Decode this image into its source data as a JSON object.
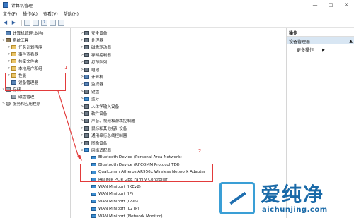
{
  "window": {
    "title": "计算机管理",
    "controls": [
      "—",
      "□",
      "✕"
    ]
  },
  "menubar": [
    "文件(F)",
    "操作(A)",
    "查看(V)",
    "帮助(H)"
  ],
  "toolbar": [
    "back-icon",
    "forward-icon",
    "folder-icon",
    "properties-icon",
    "help-icon",
    "view-icon",
    "monitor-icon"
  ],
  "left_tree": [
    {
      "label": "计算机管理(本地)",
      "arrow": "",
      "icon": "pc"
    },
    {
      "label": "系统工具",
      "arrow": "∨",
      "icon": "tool"
    },
    {
      "label": "任务计划程序",
      "arrow": ">",
      "icon": "folder"
    },
    {
      "label": "事件查看器",
      "arrow": ">",
      "icon": "folder"
    },
    {
      "label": "共享文件夹",
      "arrow": ">",
      "icon": "folder"
    },
    {
      "label": "本地用户和组",
      "arrow": ">",
      "icon": "folder"
    },
    {
      "label": "性能",
      "arrow": ">",
      "icon": "folder"
    },
    {
      "label": "设备管理器",
      "arrow": "",
      "icon": "pc"
    },
    {
      "label": "存储",
      "arrow": "∨",
      "icon": "disk"
    },
    {
      "label": "磁盘管理",
      "arrow": "",
      "icon": "disk"
    },
    {
      "label": "服务和应用程序",
      "arrow": ">",
      "icon": "svc"
    }
  ],
  "device_tree": [
    {
      "label": "安全设备",
      "arrow": ">",
      "icon": "dev"
    },
    {
      "label": "处理器",
      "arrow": ">",
      "icon": "dev"
    },
    {
      "label": "磁盘驱动器",
      "arrow": ">",
      "icon": "dev"
    },
    {
      "label": "存储控制器",
      "arrow": ">",
      "icon": "dev"
    },
    {
      "label": "打印队列",
      "arrow": ">",
      "icon": "dev"
    },
    {
      "label": "电池",
      "arrow": ">",
      "icon": "dev"
    },
    {
      "label": "计算机",
      "arrow": ">",
      "icon": "pc"
    },
    {
      "label": "监视器",
      "arrow": ">",
      "icon": "pc"
    },
    {
      "label": "键盘",
      "arrow": ">",
      "icon": "dev"
    },
    {
      "label": "蓝牙",
      "arrow": ">",
      "icon": "net"
    },
    {
      "label": "人体学输入设备",
      "arrow": ">",
      "icon": "dev"
    },
    {
      "label": "软件设备",
      "arrow": ">",
      "icon": "dev"
    },
    {
      "label": "声音、视频和游戏控制器",
      "arrow": ">",
      "icon": "dev"
    },
    {
      "label": "鼠标和其他指针设备",
      "arrow": ">",
      "icon": "dev"
    },
    {
      "label": "通用串行总线控制器",
      "arrow": ">",
      "icon": "dev"
    },
    {
      "label": "图像设备",
      "arrow": ">",
      "icon": "dev"
    },
    {
      "label": "网络适配器",
      "arrow": "∨",
      "icon": "net"
    },
    {
      "label": "Bluetooth Device (Personal Area Network)",
      "arrow": "",
      "icon": "net"
    },
    {
      "label": "Bluetooth Device (RFCOMM Protocol TDI)",
      "arrow": "",
      "icon": "net"
    },
    {
      "label": "Qualcomm Atheros AR956x Wireless Network Adapter",
      "arrow": "",
      "icon": "net"
    },
    {
      "label": "Realtek PCIe GBE Family Controller",
      "arrow": "",
      "icon": "net"
    },
    {
      "label": "WAN Miniport (IKEv2)",
      "arrow": "",
      "icon": "net"
    },
    {
      "label": "WAN Miniport (IP)",
      "arrow": "",
      "icon": "net"
    },
    {
      "label": "WAN Miniport (IPv6)",
      "arrow": "",
      "icon": "net"
    },
    {
      "label": "WAN Miniport (L2TP)",
      "arrow": "",
      "icon": "net"
    },
    {
      "label": "WAN Miniport (Network Monitor)",
      "arrow": "",
      "icon": "net"
    }
  ],
  "actions_pane": {
    "header": "操作",
    "section": "设备管理器",
    "section_arrow": "▲",
    "more": "更多操作",
    "more_arrow": "▶"
  },
  "annotations": {
    "one": "1",
    "two": "2"
  },
  "watermark": {
    "brand": "爱纯净",
    "url": "aichunjing.com"
  },
  "colors": {
    "annotation": "#e23b3b",
    "selection": "#d8e6f3",
    "brand": "#1a6aa8"
  }
}
